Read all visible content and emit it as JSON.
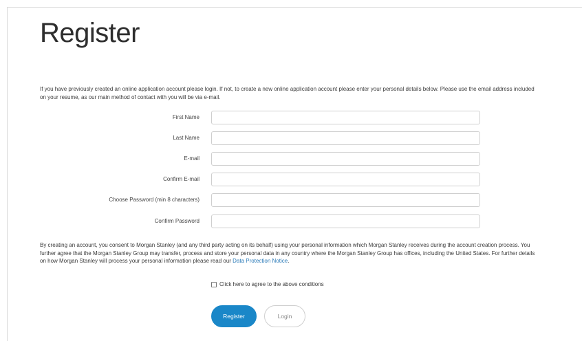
{
  "page": {
    "title": "Register",
    "intro": "If you have previously created an online application account please login. If not, to create a new online application account please enter your personal details below. Please use the email address included on your resume, as our main method of contact with you will be via e-mail."
  },
  "form": {
    "fields": [
      {
        "label": "First Name",
        "value": ""
      },
      {
        "label": "Last Name",
        "value": ""
      },
      {
        "label": "E-mail",
        "value": ""
      },
      {
        "label": "Confirm E-mail",
        "value": ""
      },
      {
        "label": "Choose Password (min 8 characters)",
        "value": ""
      },
      {
        "label": "Confirm Password",
        "value": ""
      }
    ]
  },
  "consent": {
    "text": "By creating an account, you consent to Morgan Stanley (and any third party acting on its behalf) using your personal information which Morgan Stanley receives during the account creation process. You further agree that the Morgan Stanley Group may transfer, process and store your personal data in any country where the Morgan Stanley Group has offices, including the United States. For further details on how Morgan Stanley will process your personal information please read our ",
    "link_text": "Data Protection Notice",
    "trailing": ".",
    "agree_label": "Click here to agree to the above conditions",
    "agree_checked": false
  },
  "buttons": {
    "register": "Register",
    "login": "Login"
  },
  "colors": {
    "accent": "#1a87c8",
    "link": "#2a7ab8"
  }
}
